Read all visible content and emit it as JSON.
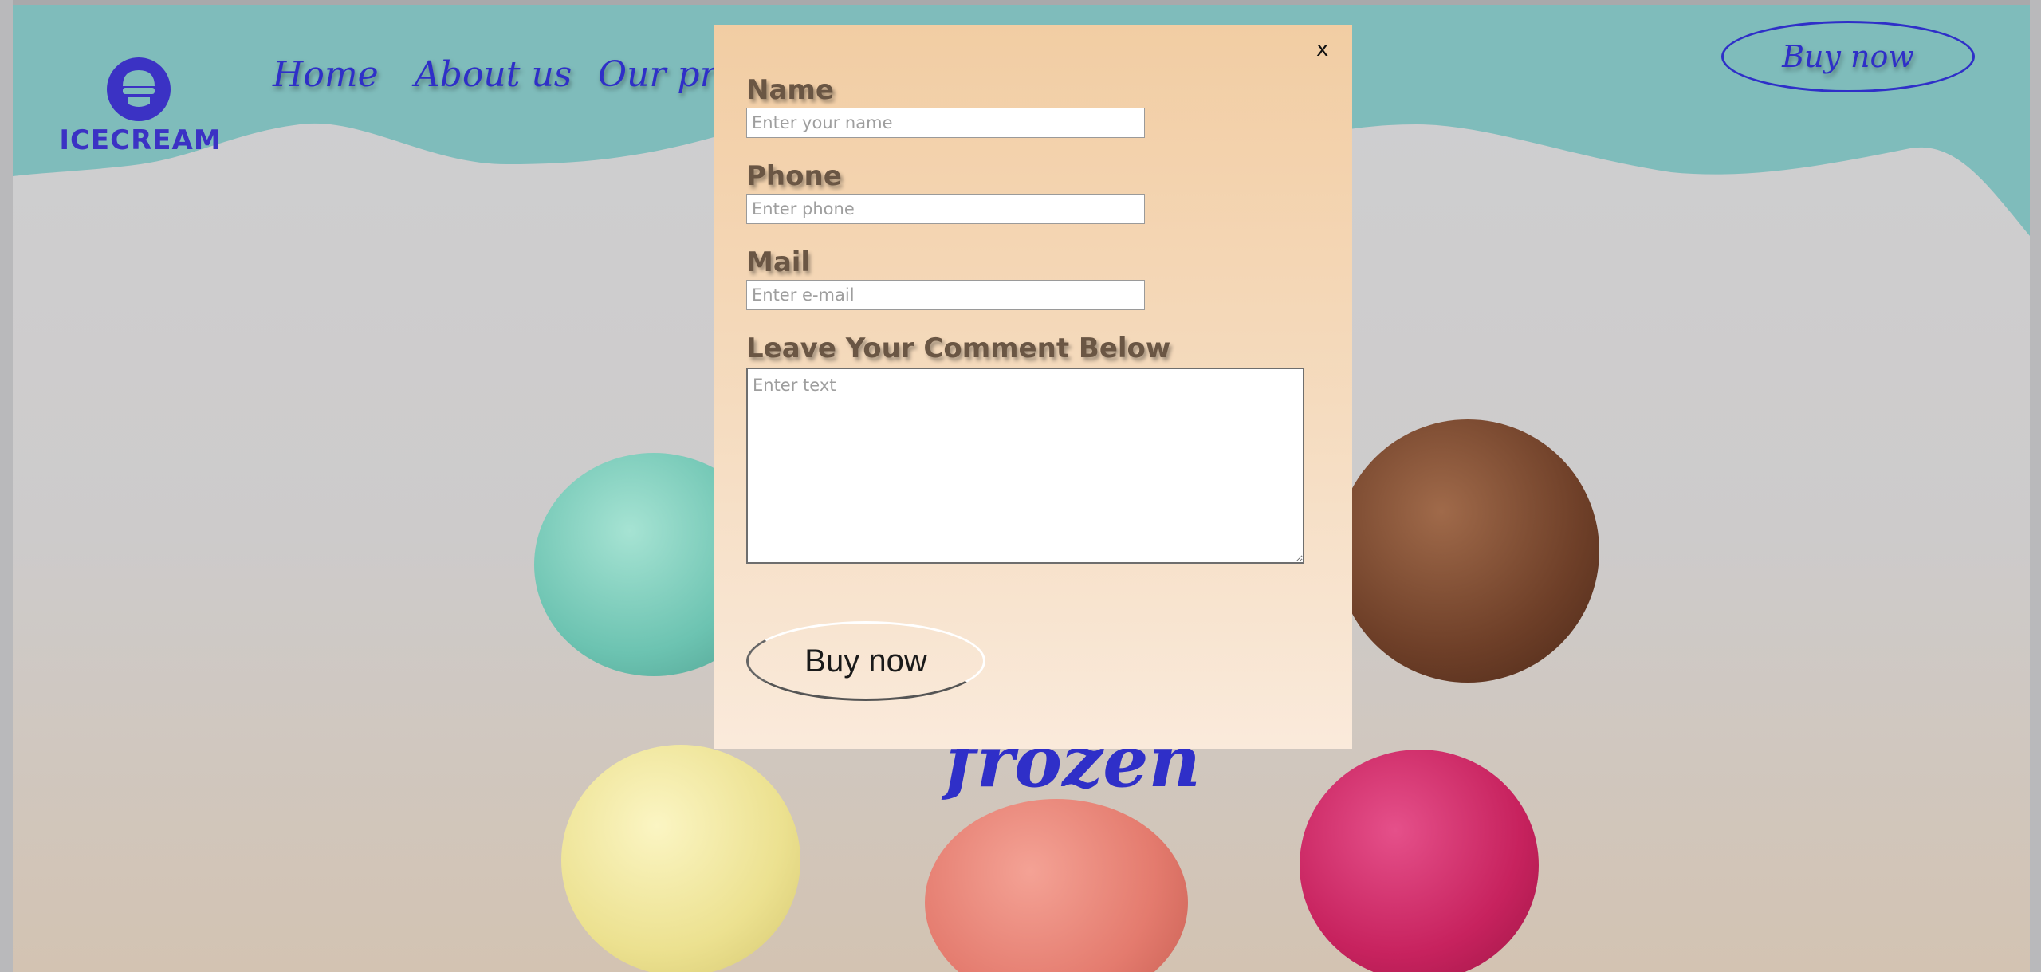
{
  "logo": {
    "text": "ICECREAM"
  },
  "nav": {
    "items": [
      "Home",
      "About us",
      "Our products"
    ]
  },
  "header": {
    "buy_label": "Buy now"
  },
  "hero": {
    "text": "frozen"
  },
  "modal": {
    "close_label": "x",
    "name_label": "Name",
    "name_placeholder": "Enter your name",
    "phone_label": "Phone",
    "phone_placeholder": "Enter phone",
    "mail_label": "Mail",
    "mail_placeholder": "Enter e-mail",
    "comment_label": "Leave Your Comment Below",
    "comment_placeholder": "Enter text",
    "buy_label": "Buy now"
  },
  "colors": {
    "accent": "#2f2fc8",
    "wave": "#7fbcbb",
    "modal_top": "#f2cda3",
    "modal_bottom": "#faeadb"
  }
}
